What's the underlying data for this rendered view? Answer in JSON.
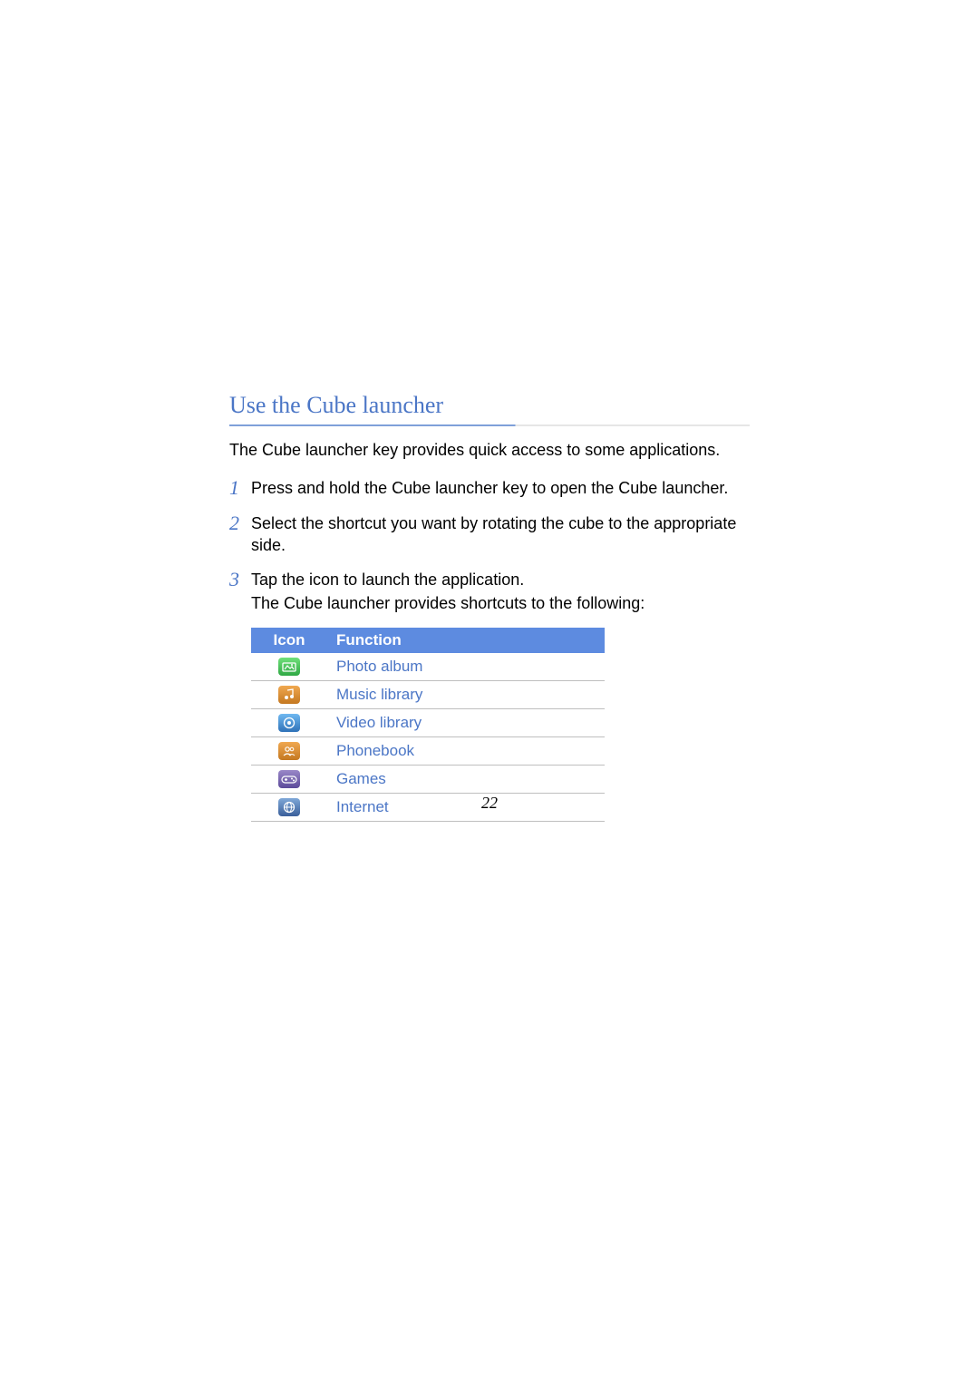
{
  "heading": "Use the Cube launcher",
  "intro": "The Cube launcher key provides quick access to some applications.",
  "steps": [
    {
      "num": "1",
      "text": "Press and hold the Cube launcher key to open the Cube launcher."
    },
    {
      "num": "2",
      "text": "Select the shortcut you want by rotating the cube to the appropriate side."
    },
    {
      "num": "3",
      "text": "Tap the icon to launch the application.",
      "sub": "The Cube launcher provides shortcuts to the following:"
    }
  ],
  "table": {
    "headers": {
      "icon": "Icon",
      "function": "Function"
    },
    "rows": [
      {
        "icon": "photo-album-icon",
        "func": "Photo album"
      },
      {
        "icon": "music-library-icon",
        "func": "Music library"
      },
      {
        "icon": "video-library-icon",
        "func": "Video library"
      },
      {
        "icon": "phonebook-icon",
        "func": "Phonebook"
      },
      {
        "icon": "games-icon",
        "func": "Games"
      },
      {
        "icon": "internet-icon",
        "func": "Internet"
      }
    ]
  },
  "page_number": "22"
}
